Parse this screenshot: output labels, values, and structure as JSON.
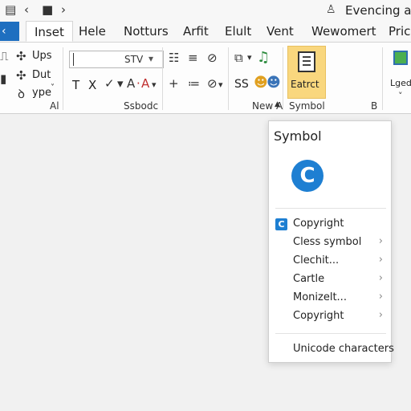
{
  "titlebar": {
    "account_name": "Evencing ac"
  },
  "tabs": [
    "Inset",
    "Hele",
    "Notturs",
    "Arfit",
    "Elult",
    "Vent",
    "Wewomert",
    "Prico"
  ],
  "ribbon": {
    "clipboard": {
      "up": "Ups",
      "dut": "Dut",
      "type": "ype",
      "group": "Al"
    },
    "font": {
      "size_value": "STV",
      "bold": "T",
      "italic": "X",
      "group": "Ssbodc"
    },
    "insert": {
      "strike": "SS",
      "group": "New A"
    },
    "symbol": {
      "extract": "Eatrct",
      "group": "Symbol",
      "b_label": "B"
    },
    "right": {
      "label": "Lgedi"
    }
  },
  "panel": {
    "title": "Symbol",
    "big_symbol": "C",
    "items": [
      {
        "label": "Copyright",
        "chevron": ""
      },
      {
        "label": "Cless symbol",
        "chevron": "›"
      },
      {
        "label": "Clechit...",
        "chevron": "›"
      },
      {
        "label": "Cartle",
        "chevron": "›"
      },
      {
        "label": "Monizelt...",
        "chevron": "›"
      },
      {
        "label": "Copyright",
        "chevron": "›"
      }
    ],
    "footer": "Unicode characters"
  },
  "colors": {
    "accent": "#1e7fd2",
    "highlight": "#f9d77e"
  }
}
